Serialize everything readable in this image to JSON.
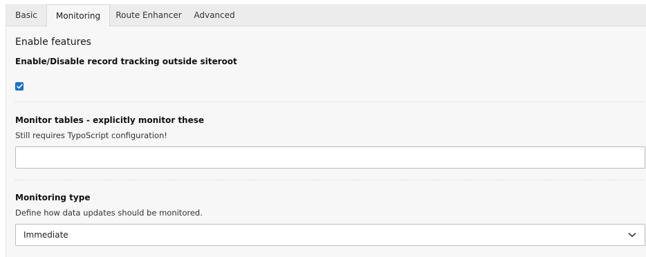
{
  "tabs": [
    {
      "label": "Basic",
      "active": false
    },
    {
      "label": "Monitoring",
      "active": true
    },
    {
      "label": "Route Enhancer",
      "active": false
    },
    {
      "label": "Advanced",
      "active": false
    }
  ],
  "section": {
    "title": "Enable features"
  },
  "fields": {
    "record_tracking": {
      "label": "Enable/Disable record tracking outside siteroot",
      "checked": true
    },
    "monitor_tables": {
      "label": "Monitor tables - explicitly monitor these",
      "description": "Still requires TypoScript configuration!",
      "value": ""
    },
    "monitoring_type": {
      "label": "Monitoring type",
      "description": "Define how data updates should be monitored.",
      "selected": "Immediate"
    }
  },
  "colors": {
    "accent": "#1a73d8",
    "tabbar": "#ececec",
    "panel": "#f7f7f7"
  },
  "icons": {
    "checkbox": "check-icon",
    "dropdown": "chevron-down-icon"
  }
}
